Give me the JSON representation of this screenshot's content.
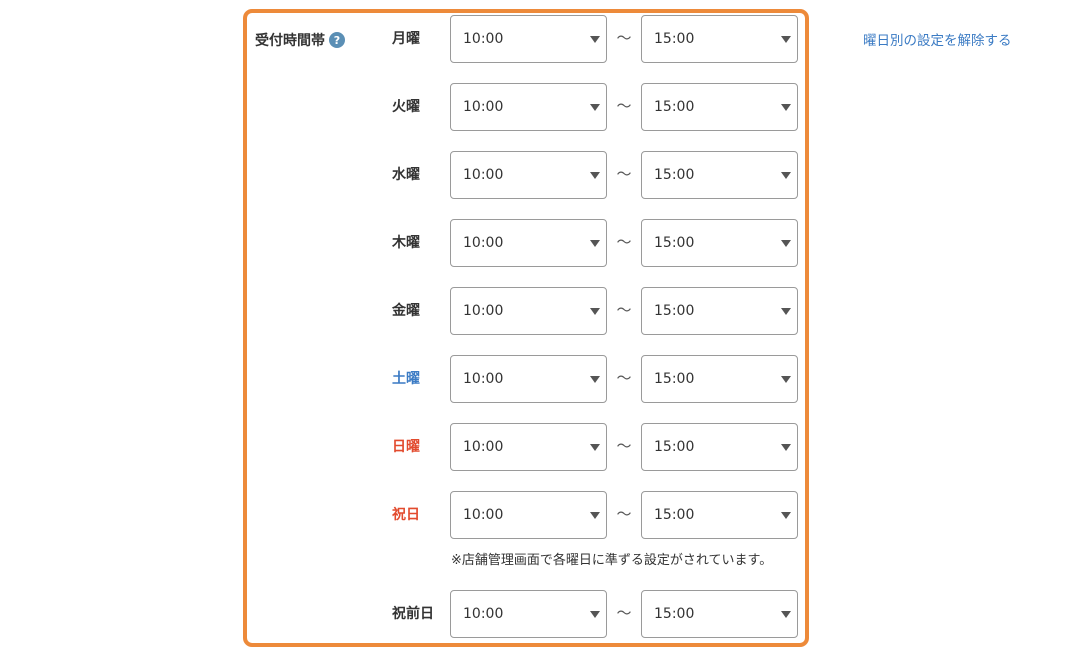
{
  "section": {
    "label": "受付時間帯",
    "help_glyph": "?",
    "reset_link": "曜日別の設定を解除する"
  },
  "colors": {
    "frame": "#ED8A3A",
    "default_day": "#333333",
    "saturday": "#3B7BC4",
    "sunday_holiday": "#E24B2E",
    "link": "#3B7BC4",
    "help_icon": "#5B8FB5"
  },
  "separator": "〜",
  "days": [
    {
      "label": "月曜",
      "start": "10:00",
      "end": "15:00",
      "color": "#333333"
    },
    {
      "label": "火曜",
      "start": "10:00",
      "end": "15:00",
      "color": "#333333"
    },
    {
      "label": "水曜",
      "start": "10:00",
      "end": "15:00",
      "color": "#333333"
    },
    {
      "label": "木曜",
      "start": "10:00",
      "end": "15:00",
      "color": "#333333"
    },
    {
      "label": "金曜",
      "start": "10:00",
      "end": "15:00",
      "color": "#333333"
    },
    {
      "label": "土曜",
      "start": "10:00",
      "end": "15:00",
      "color": "#3B7BC4"
    },
    {
      "label": "日曜",
      "start": "10:00",
      "end": "15:00",
      "color": "#E24B2E"
    },
    {
      "label": "祝日",
      "start": "10:00",
      "end": "15:00",
      "color": "#E24B2E"
    },
    {
      "label": "祝前日",
      "start": "10:00",
      "end": "15:00",
      "color": "#333333"
    }
  ],
  "holiday_note": "※店舗管理画面で各曜日に準ずる設定がされています。"
}
